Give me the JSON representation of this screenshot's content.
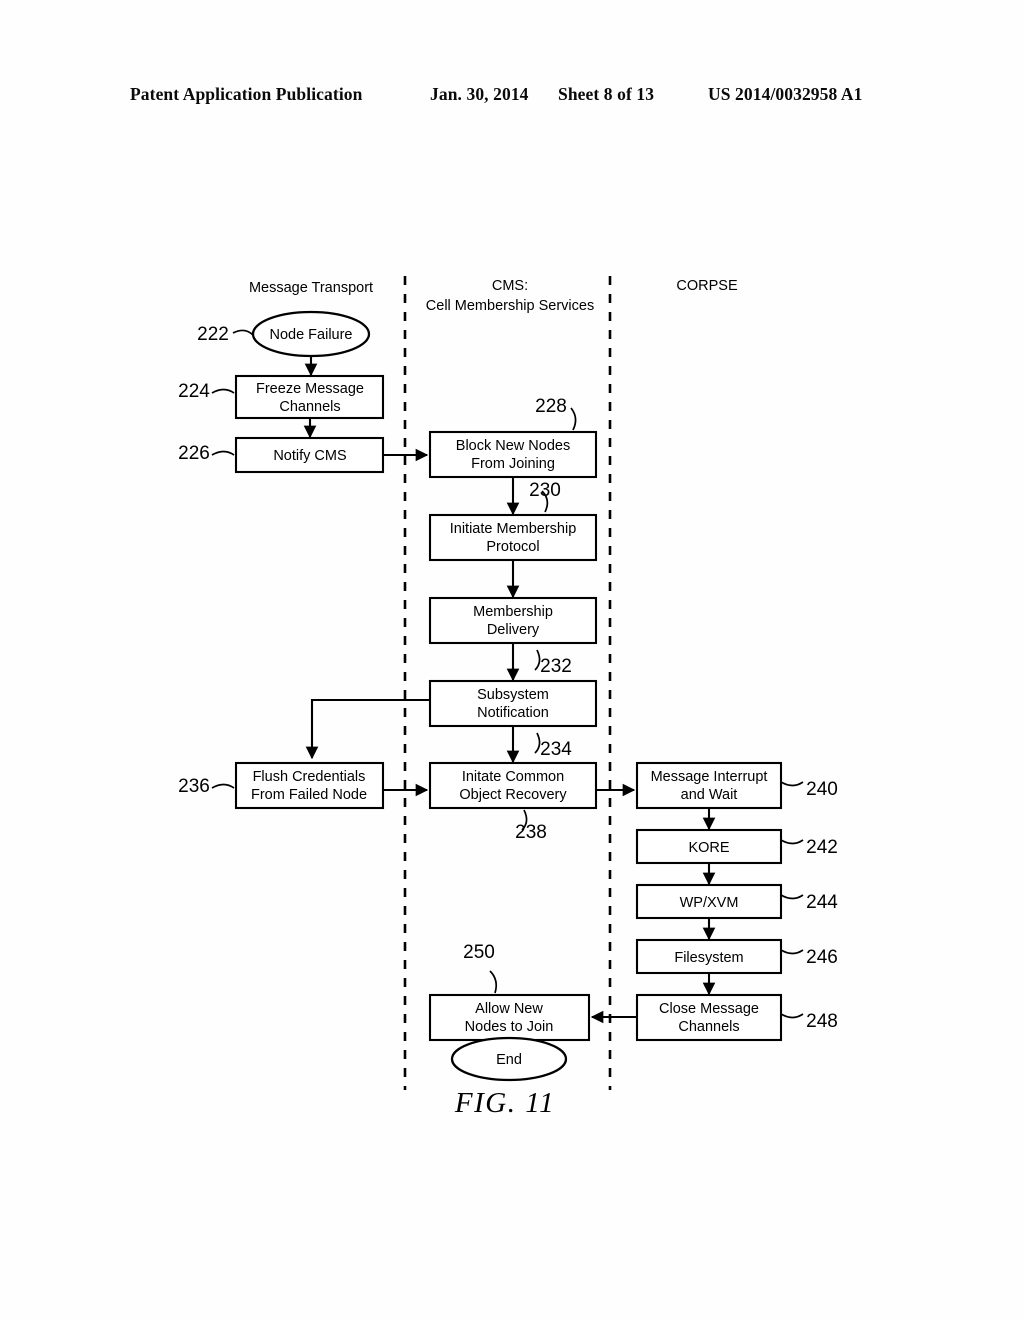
{
  "header": {
    "title": "Patent Application Publication",
    "date": "Jan. 30, 2014",
    "sheet": "Sheet 8 of 13",
    "patent_number": "US 2014/0032958 A1"
  },
  "figure": {
    "caption": "FIG. 11",
    "lanes": [
      {
        "id": "lane-message-transport",
        "label": "Message Transport",
        "label2": ""
      },
      {
        "id": "lane-cms",
        "label": "CMS:",
        "label2": "Cell Membership Services"
      },
      {
        "id": "lane-corpse",
        "label": "CORPSE",
        "label2": ""
      }
    ],
    "nodes": [
      {
        "id": "node-failure",
        "lane": "message-transport",
        "shape": "ellipse",
        "ref": "222",
        "line1": "Node Failure",
        "line2": ""
      },
      {
        "id": "freeze-message-channels",
        "lane": "message-transport",
        "shape": "box",
        "ref": "224",
        "line1": "Freeze Message",
        "line2": "Channels"
      },
      {
        "id": "notify-cms",
        "lane": "message-transport",
        "shape": "box",
        "ref": "226",
        "line1": "Notify CMS",
        "line2": ""
      },
      {
        "id": "block-new-nodes",
        "lane": "cms",
        "shape": "box",
        "ref": "228",
        "line1": "Block New Nodes",
        "line2": "From Joining"
      },
      {
        "id": "initiate-membership",
        "lane": "cms",
        "shape": "box",
        "ref": "230",
        "line1": "Initiate Membership",
        "line2": "Protocol"
      },
      {
        "id": "membership-delivery",
        "lane": "cms",
        "shape": "box",
        "ref": "",
        "line1": "Membership",
        "line2": "Delivery"
      },
      {
        "id": "subsystem-notification",
        "lane": "cms",
        "shape": "box",
        "ref": "232",
        "line1": "Subsystem",
        "line2": "Notification"
      },
      {
        "id": "flush-credentials",
        "lane": "message-transport",
        "shape": "box",
        "ref": "236",
        "line1": "Flush Credentials",
        "line2": "From Failed Node"
      },
      {
        "id": "initate-common-object",
        "lane": "cms",
        "shape": "box",
        "ref": "234",
        "line1": "Initate Common",
        "line2": "Object Recovery"
      },
      {
        "id": "message-interrupt",
        "lane": "corpse",
        "shape": "box",
        "ref": "240",
        "line1": "Message Interrupt",
        "line2": "and Wait"
      },
      {
        "id": "kore",
        "lane": "corpse",
        "shape": "box",
        "ref": "242",
        "line1": "KORE",
        "line2": ""
      },
      {
        "id": "wp-xvm",
        "lane": "corpse",
        "shape": "box",
        "ref": "244",
        "line1": "WP/XVM",
        "line2": ""
      },
      {
        "id": "filesystem",
        "lane": "corpse",
        "shape": "box",
        "ref": "246",
        "line1": "Filesystem",
        "line2": ""
      },
      {
        "id": "close-message-channels",
        "lane": "corpse",
        "shape": "box",
        "ref": "248",
        "line1": "Close Message",
        "line2": "Channels"
      },
      {
        "id": "allow-new-nodes",
        "lane": "cms",
        "shape": "box",
        "ref": "250",
        "line1": "Allow New",
        "line2": "Nodes to Join"
      },
      {
        "id": "end",
        "lane": "cms",
        "shape": "ellipse",
        "ref": "",
        "line1": "End",
        "line2": ""
      }
    ],
    "extra_refs": [
      {
        "id": "ref-238",
        "value": "238",
        "for": "initate-common-object"
      }
    ]
  }
}
